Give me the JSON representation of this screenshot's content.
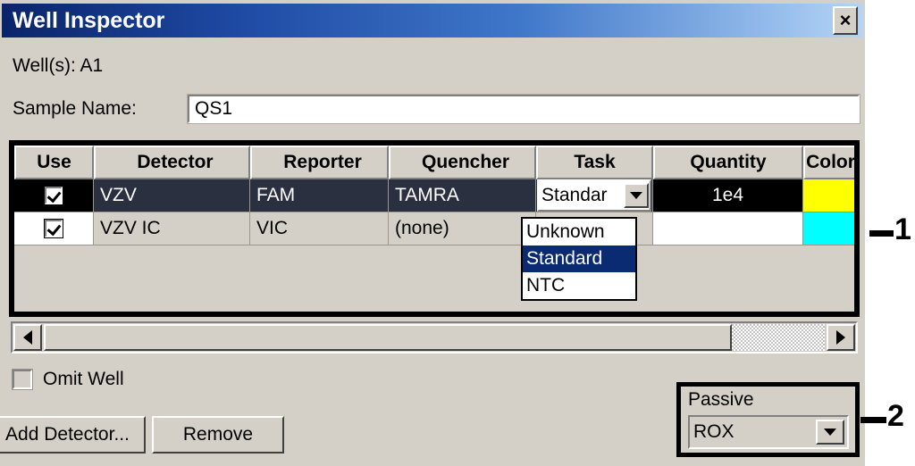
{
  "window": {
    "title": "Well Inspector",
    "close_label": "×"
  },
  "form": {
    "well_label": "Well(s): A1",
    "sample_name_label": "Sample Name:",
    "sample_name_value": "QS1"
  },
  "table": {
    "headers": [
      "Use",
      "Detector",
      "Reporter",
      "Quencher",
      "Task",
      "Quantity",
      "Color"
    ],
    "rows": [
      {
        "use_checked": true,
        "detector": "VZV",
        "reporter": "FAM",
        "quencher": "TAMRA",
        "task": "Standard",
        "task_display": "Standar",
        "quantity": "1e4",
        "color": "#FFFF00",
        "selected": true
      },
      {
        "use_checked": true,
        "detector": "VZV IC",
        "reporter": "VIC",
        "quencher": "(none)",
        "task": "",
        "task_display": "",
        "quantity": "",
        "color": "#00FFFF",
        "selected": false
      }
    ]
  },
  "task_dropdown": {
    "open": true,
    "selected": "Standard",
    "options": [
      {
        "label": "Unknown",
        "selected": false
      },
      {
        "label": "Standard",
        "selected": true
      },
      {
        "label": "NTC",
        "selected": false
      }
    ]
  },
  "omit": {
    "label": "Omit Well",
    "checked": false
  },
  "buttons": {
    "add_detector": "Add Detector...",
    "remove": "Remove"
  },
  "passive": {
    "label": "Passive",
    "value": "ROX"
  },
  "annotations": [
    {
      "number": "1"
    },
    {
      "number": "2"
    }
  ],
  "colors": {
    "titlebar_start": "#0a246a",
    "titlebar_end": "#b6d4f4",
    "dialog_face": "#d4d0c8",
    "selected_row": "#2b3040",
    "highlight": "#0a2a72",
    "row1_color": "#FFFF00",
    "row2_color": "#00FFFF"
  }
}
